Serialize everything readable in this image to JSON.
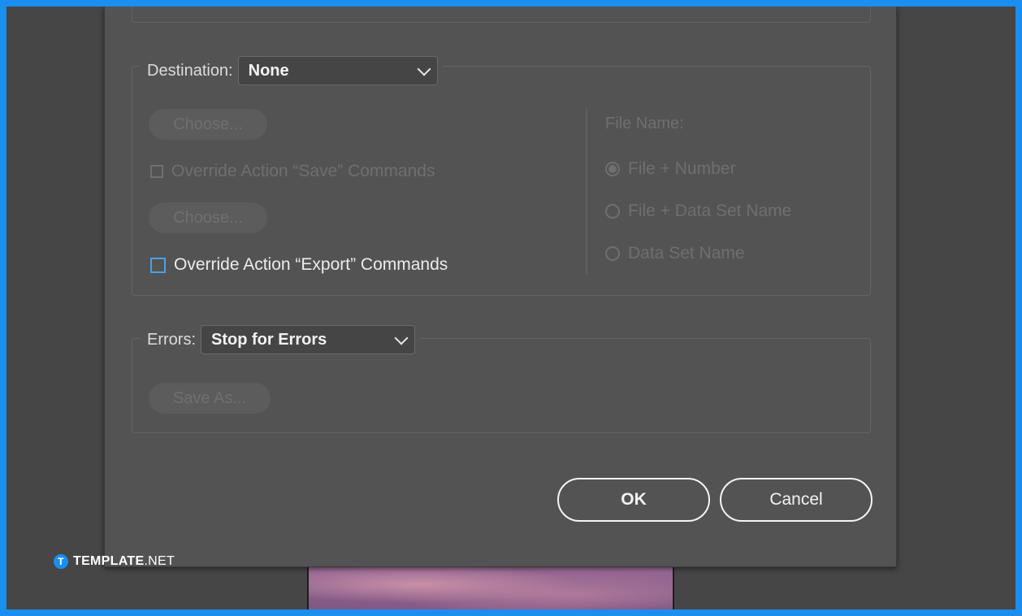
{
  "destination": {
    "label": "Destination:",
    "selected": "None",
    "choose_label": "Choose...",
    "override_save_label": "Override Action “Save” Commands",
    "choose2_label": "Choose...",
    "override_export_label": "Override Action “Export” Commands"
  },
  "file_name": {
    "label": "File Name:",
    "options": [
      "File + Number",
      "File + Data Set Name",
      "Data Set Name"
    ]
  },
  "errors": {
    "label": "Errors:",
    "selected": "Stop for Errors",
    "save_as_label": "Save As..."
  },
  "buttons": {
    "ok": "OK",
    "cancel": "Cancel"
  },
  "watermark": {
    "logo_letter": "T",
    "brand": "TEMPLATE",
    "suffix": ".NET"
  },
  "colors": {
    "accent": "#1a8ff0",
    "dialog_bg": "#535353",
    "checkbox_focus": "#4aa0e6"
  }
}
